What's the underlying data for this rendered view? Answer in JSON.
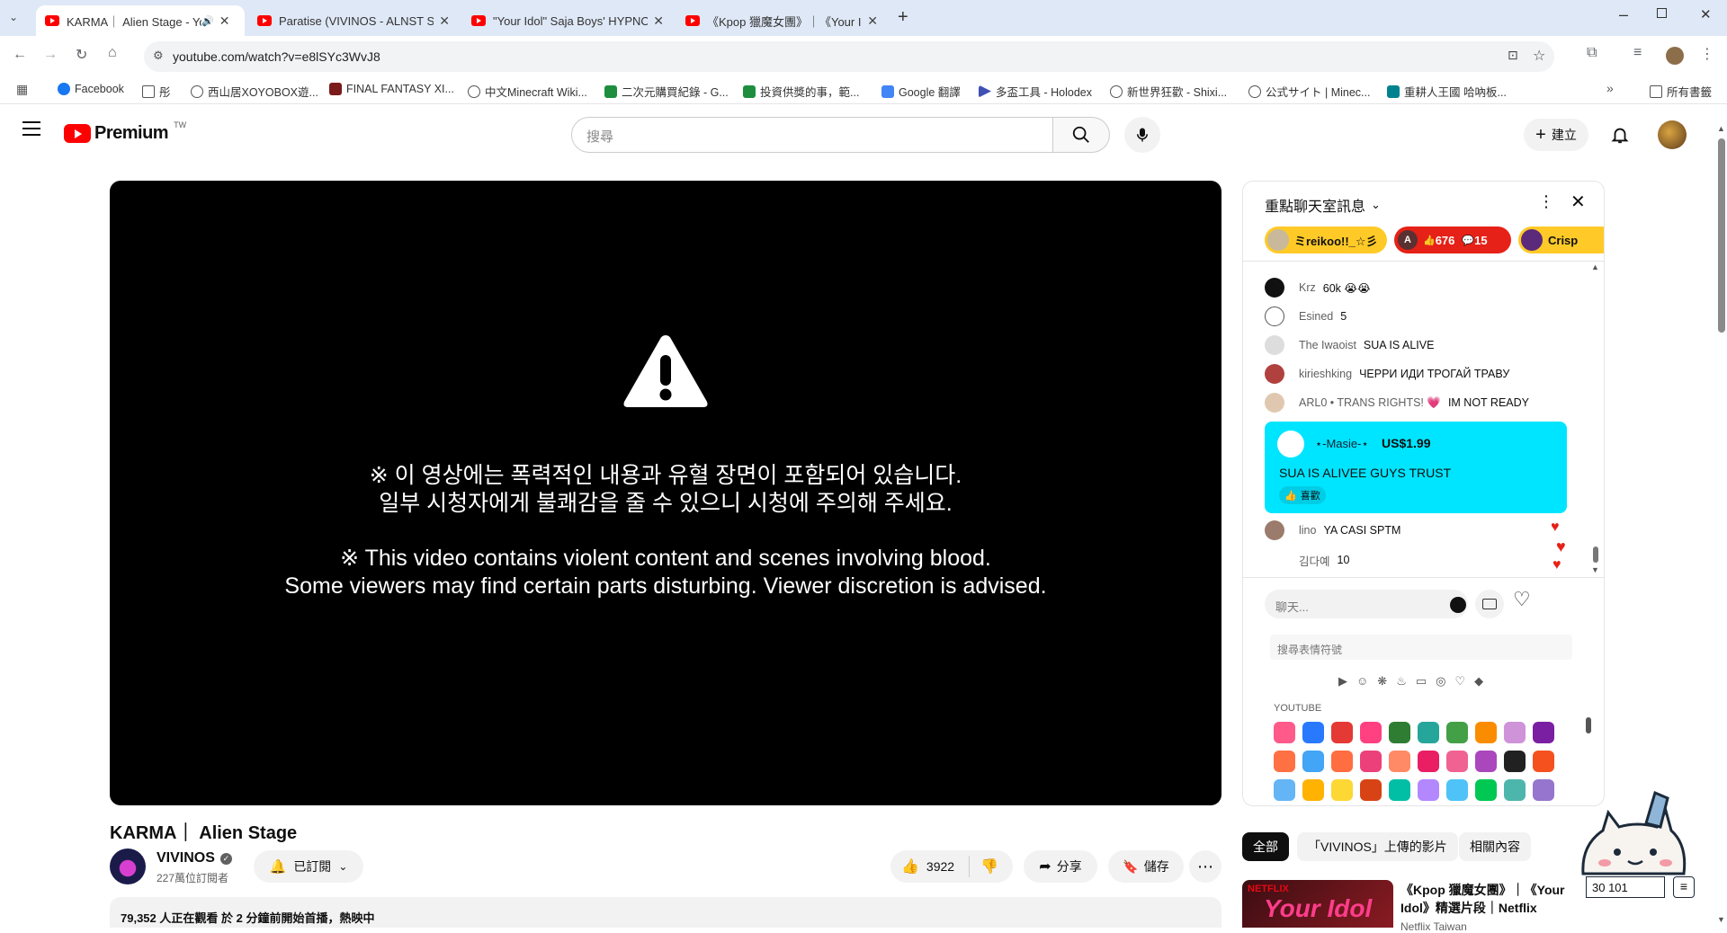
{
  "tabs": [
    {
      "title": "KARMA｜ Alien Stage - Yo",
      "active": true
    },
    {
      "title": "Paratise (VIVINOS - ALNST Su",
      "active": false
    },
    {
      "title": "\"Your Idol\" Saja Boys' HYPNO",
      "active": false
    },
    {
      "title": "《Kpop 獵魔女團》｜《Your Id",
      "active": false
    }
  ],
  "url": "youtube.com/watch?v=e8lSYc3WvJ8",
  "bookmarks": [
    "Facebook",
    "彤",
    "西山居XOYOBOX遊...",
    "FINAL FANTASY XI...",
    "中文Minecraft Wiki...",
    "二次元購買紀錄 - G...",
    "投資供獎的事，範...",
    "Google 翻譯",
    "多盃工具 - Holodex",
    "新世界狂歡 - Shixi...",
    "公式サイト | Minec...",
    "重耕人王國 哈吶板..."
  ],
  "bookmarks_all": "所有書籤",
  "yt": {
    "logo": "Premium",
    "region": "TW",
    "search_placeholder": "搜尋",
    "create_label": "建立"
  },
  "video": {
    "warning_ko_1": "※ 이 영상에는 폭력적인 내용과 유혈 장면이 포함되어 있습니다.",
    "warning_ko_2": "일부 시청자에게 불쾌감을 줄 수 있으니 시청에 주의해 주세요.",
    "warning_en_1": "※ This video contains violent content and scenes involving blood.",
    "warning_en_2": "Some viewers may find certain parts disturbing. Viewer discretion is advised.",
    "title": "KARMA｜ Alien Stage",
    "channel": "VIVINOS",
    "subscribers": "227萬位訂閱者",
    "subscribed_label": "已訂閱",
    "likes": "3922",
    "share_label": "分享",
    "save_label": "儲存",
    "description": "79,352 人正在觀看 於 2 分鐘前開始首播，熱映中"
  },
  "chat": {
    "header": "重點聊天室訊息",
    "tickers": [
      {
        "name": "ミreikoo!!_☆彡",
        "color": "#ffca28"
      },
      {
        "name": "A",
        "likes": "676",
        "replies": "15",
        "color": "#e62117"
      },
      {
        "name": "Crisp",
        "color": "#ffca28"
      }
    ],
    "messages": [
      {
        "author": "Krz",
        "text": "60k 😭😭"
      },
      {
        "author": "Esined",
        "text": "5"
      },
      {
        "author": "The Iwaoist",
        "text": "SUA IS ALIVE"
      },
      {
        "author": "kirieshking",
        "text": "ЧЕРРИ ИДИ ТРОГАЙ ТРАВУ"
      },
      {
        "author": "ARL0 • TRANS RIGHTS! 💗",
        "text": "IM NOT READY"
      }
    ],
    "superchat": {
      "author": "⋆-Masie-⋆",
      "amount": "US$1.99",
      "text": "SUA IS ALIVEE GUYS TRUST",
      "like_label": "喜歡",
      "color": "#00e5ff"
    },
    "messages_after": [
      {
        "author": "lino",
        "text": "YA CASI SPTM"
      },
      {
        "author": "김다예",
        "text": "10"
      }
    ],
    "input_placeholder": "聊天...",
    "emoji_search_placeholder": "搜尋表情符號",
    "emoji_section": "YOUTUBE"
  },
  "chips": [
    "全部",
    "「VIVINOS」上傳的影片",
    "相關內容"
  ],
  "recommended": {
    "title_1": "《Kpop 獵魔女團》｜《Your",
    "title_2": "Idol》精選片段｜Netflix",
    "channel": "Netflix Taiwan",
    "brand": "NETFLIX",
    "thumb_text": "Your Idol"
  },
  "widget_counter": "30 101"
}
